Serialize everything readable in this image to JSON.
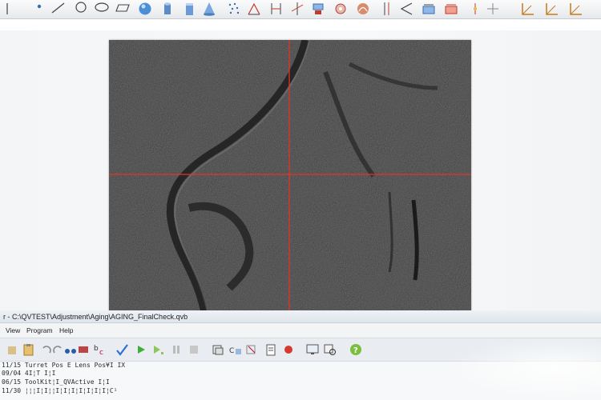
{
  "window": {
    "title": "r - C:\\QVTEST\\Adjustment\\Aging\\AGING_FinalCheck.qvb"
  },
  "menu": [
    {
      "label": "View"
    },
    {
      "label": "Program"
    },
    {
      "label": "Help"
    }
  ],
  "toolbar_icons": [
    "point-icon",
    "line-icon",
    "circle-icon",
    "ellipse-icon",
    "plane-icon",
    "sphere-icon",
    "cylinder-icon",
    "cone-icon",
    "box-icon",
    "point-cloud-icon",
    "angle-icon",
    "distance-icon",
    "intersection-icon",
    "construct-icon",
    "profile-icon",
    "surface-icon",
    "parallel-icon",
    "symmetry-icon",
    "measure-icon",
    "tolerance-icon",
    "align-icon",
    "move-icon",
    "coordinate-icon",
    "origin-icon",
    "axis-icon"
  ],
  "program_toolbar_icons": [
    "tool-icon",
    "paste-icon",
    "undo-icon",
    "redo-icon",
    "find-icon",
    "binoculars-icon",
    "bc-icon",
    "check-icon",
    "run-icon",
    "step-run-icon",
    "pause-icon",
    "stop-icon",
    "insert-icon",
    "copy-code-icon",
    "cut-icon",
    "edit-icon",
    "record-icon",
    "monitor-icon",
    "zoom-icon",
    "help-icon"
  ],
  "code_lines": [
    {
      "text": "11/15 Turret Pos E Lens Pos¥I IX"
    },
    {
      "text": "09/04 4I¦T I¦I"
    },
    {
      "text": "06/15 ToolKit¦I_QVActive I¦I"
    },
    {
      "text": "11/30 ¦¦¦I¦I¦¦I¦I¦I¦I¦I¦I¦I¦C¹"
    }
  ],
  "camera": {
    "crosshair_color": "#e0342a"
  },
  "colors": {
    "check": "#2f6fd1",
    "run": "#3fae3a",
    "record": "#d63a2e",
    "help": "#7cbf3e"
  }
}
